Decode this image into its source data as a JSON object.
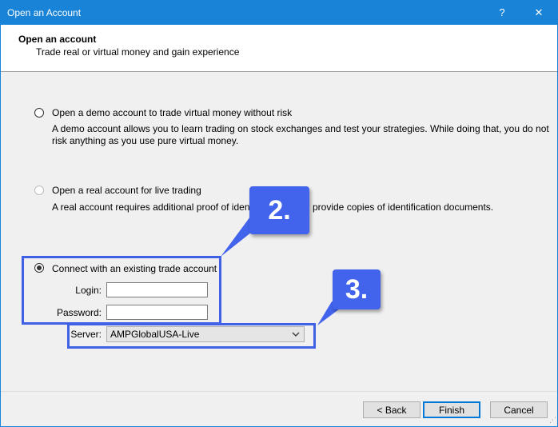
{
  "window": {
    "title": "Open an Account",
    "help": "?",
    "close": "✕"
  },
  "header": {
    "title": "Open an account",
    "subtitle": "Trade real or virtual money and gain experience"
  },
  "options": {
    "demo": {
      "label": "Open a demo account to trade virtual money without risk",
      "desc_line1": "A demo account allows you to learn trading on stock exchanges and test your strategies. While doing that, you do not",
      "desc_line2": "risk anything as you use pure virtual money."
    },
    "real": {
      "label": "Open a real account for live trading",
      "desc_left": "A real account requires additional proof of identity.",
      "desc_right": "provide copies of identification documents."
    },
    "existing": {
      "label": "Connect with an existing trade account"
    }
  },
  "login": {
    "label": "Login:",
    "value": ""
  },
  "password": {
    "label": "Password:",
    "value": ""
  },
  "server": {
    "label": "Server:",
    "value": "AMPGlobalUSA-Live"
  },
  "callouts": {
    "step2": "2.",
    "step3": "3."
  },
  "buttons": {
    "back": "< Back",
    "finish": "Finish",
    "cancel": "Cancel"
  },
  "colors": {
    "titlebar": "#1883d7",
    "callout": "#4263eb",
    "highlight_border": "#4060e8"
  }
}
